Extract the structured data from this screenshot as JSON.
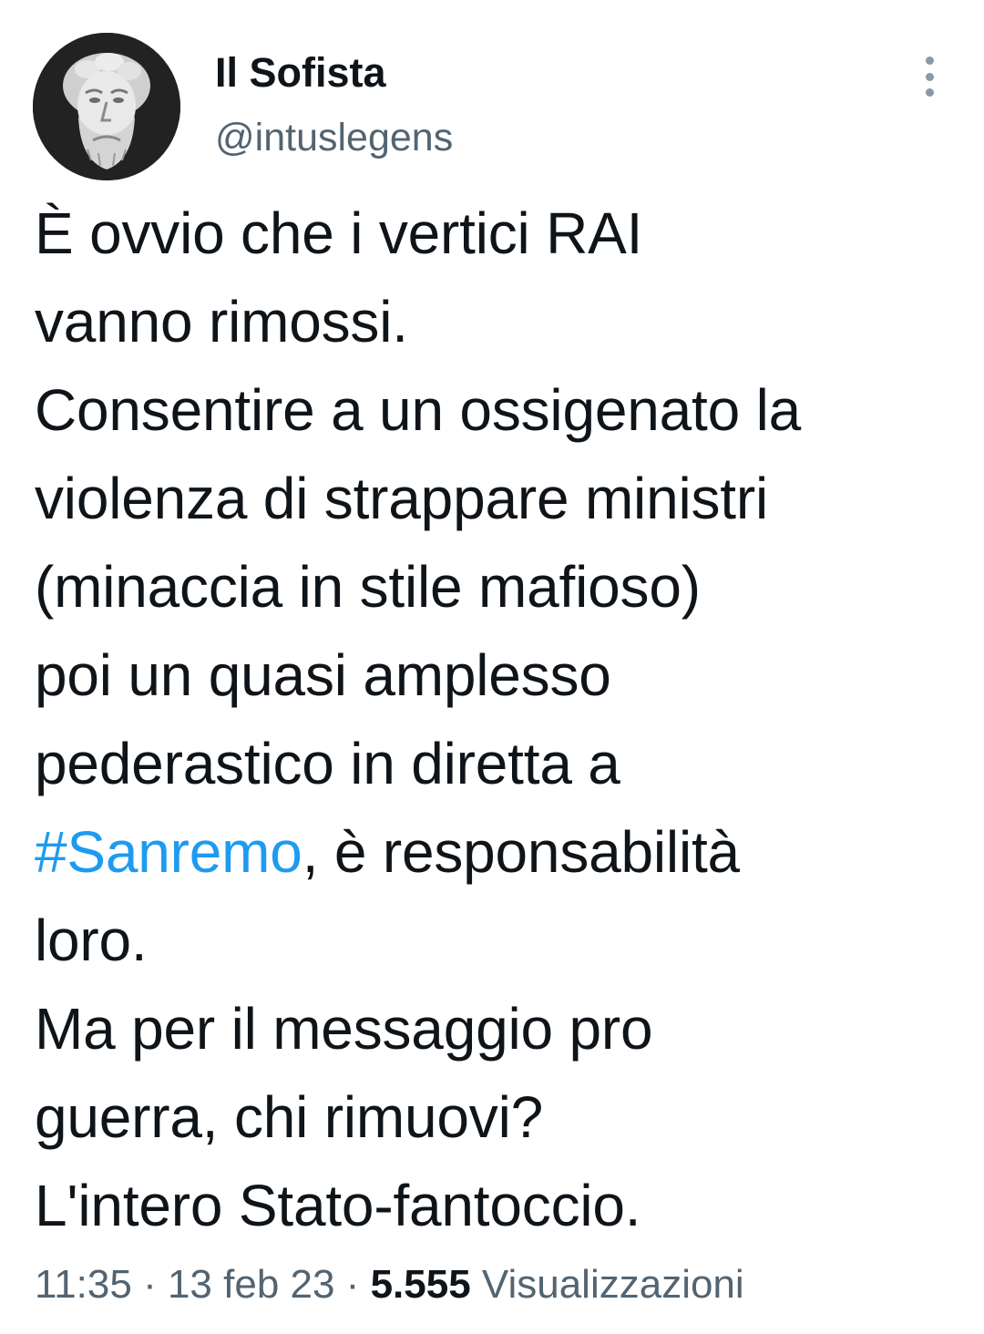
{
  "author": {
    "display_name": "Il Sofista",
    "handle": "@intuslegens",
    "avatar_icon": "classical-bust-avatar"
  },
  "menu": {
    "icon": "more-vertical-icon"
  },
  "tweet": {
    "lines": {
      "l1": "È ovvio che i vertici RAI",
      "l2": "vanno rimossi.",
      "l3": "Consentire a un ossigenato la",
      "l4": "violenza di strappare ministri",
      "l5": "(minaccia in stile mafioso)",
      "l6": "poi un quasi amplesso",
      "l7": "pederastico in diretta a",
      "l8_hashtag": "#Sanremo",
      "l8_rest": ", è responsabilità",
      "l9": "loro.",
      "l10": "Ma per il messaggio pro",
      "l11": "guerra, chi rimuovi?",
      "l12": "L'intero Stato-fantoccio."
    },
    "hashtag_color": "#1d9bf0"
  },
  "meta": {
    "time": "11:35",
    "separator": " · ",
    "date": "13 feb 23",
    "views_count": "5.555",
    "views_label": " Visualizzazioni"
  }
}
